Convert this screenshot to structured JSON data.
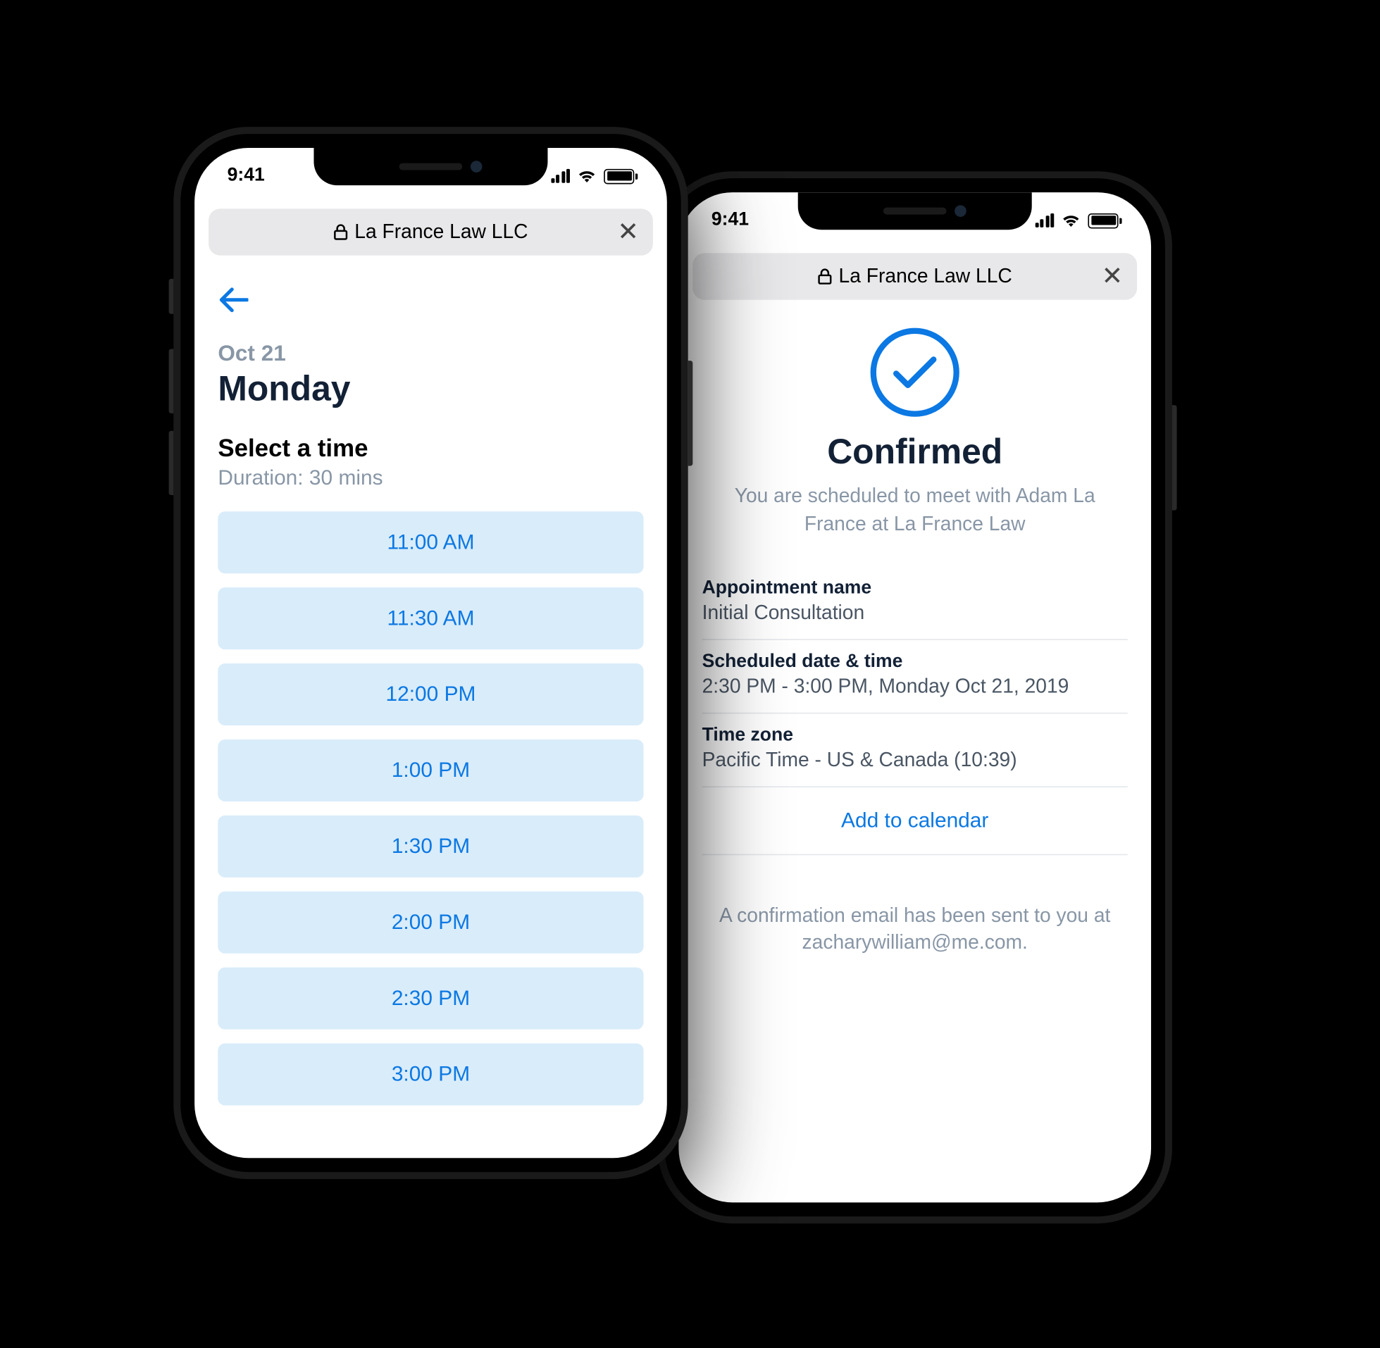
{
  "statusBar": {
    "time": "9:41"
  },
  "browser": {
    "site": "La France Law LLC"
  },
  "picker": {
    "date": "Oct 21",
    "day": "Monday",
    "selectLabel": "Select a time",
    "duration": "Duration: 30 mins",
    "slots": [
      "11:00 AM",
      "11:30 AM",
      "12:00 PM",
      "1:00 PM",
      "1:30 PM",
      "2:00 PM",
      "2:30 PM",
      "3:00 PM"
    ]
  },
  "confirm": {
    "title": "Confirmed",
    "subtitle": "You are scheduled to meet with Adam La France at La France Law",
    "details": [
      {
        "label": "Appointment name",
        "value": "Initial Consultation"
      },
      {
        "label": "Scheduled date & time",
        "value": "2:30 PM - 3:00 PM, Monday Oct 21, 2019"
      },
      {
        "label": "Time zone",
        "value": "Pacific Time - US & Canada (10:39)"
      }
    ],
    "addCalendar": "Add to calendar",
    "emailNote": "A confirmation email has been sent to you at zacharywilliam@me.com."
  }
}
